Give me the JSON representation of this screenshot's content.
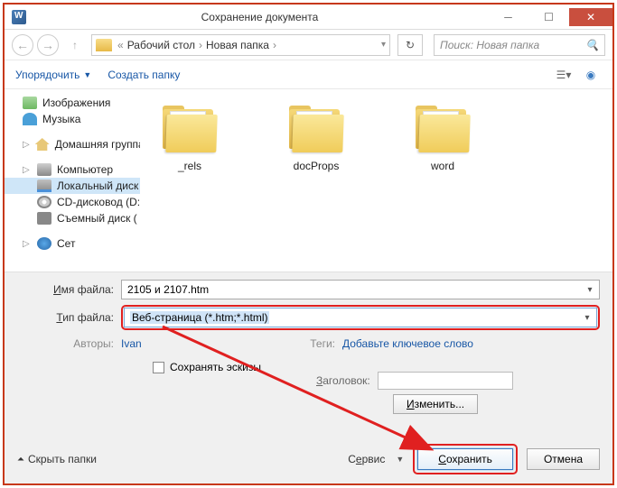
{
  "title": "Сохранение документа",
  "nav": {
    "back": "←",
    "forward": "→",
    "up": "↑",
    "breadcrumb": [
      "Рабочий стол",
      "Новая папка"
    ],
    "bc_prefix": "«",
    "refresh": "↻",
    "search_placeholder": "Поиск: Новая папка"
  },
  "toolbar": {
    "organize": "Упорядочить",
    "new_folder": "Создать папку"
  },
  "sidebar": {
    "items": [
      {
        "label": "Изображения",
        "icon": "pic"
      },
      {
        "label": "Музыка",
        "icon": "mus"
      },
      {
        "label": "",
        "spacer": true
      },
      {
        "label": "Домашняя группа",
        "icon": "home"
      },
      {
        "label": "",
        "spacer": true
      },
      {
        "label": "Компьютер",
        "icon": "comp"
      },
      {
        "label": "Локальный диск",
        "icon": "disk",
        "child": true,
        "selected": true
      },
      {
        "label": "CD-дисковод (D:",
        "icon": "cd",
        "child": true
      },
      {
        "label": "Съемный диск (",
        "icon": "usb",
        "child": true
      },
      {
        "label": "",
        "spacer": true
      },
      {
        "label": "Сет",
        "icon": "net"
      }
    ]
  },
  "folders": [
    {
      "name": "_rels",
      "type": "globe"
    },
    {
      "name": "docProps",
      "type": "plain"
    },
    {
      "name": "word",
      "type": "plain"
    }
  ],
  "form": {
    "filename_label": "Имя файла:",
    "filename_value": "2105 и 2107.htm",
    "filetype_label": "Тип файла:",
    "filetype_value": "Веб-страница (*.htm;*.html)",
    "authors_label": "Авторы:",
    "authors_value": "Ivan",
    "tags_label": "Теги:",
    "tags_value": "Добавьте ключевое слово",
    "save_thumb": "Сохранять эскизы",
    "title_label": "Заголовок:",
    "change_btn": "Изменить..."
  },
  "footer": {
    "hide_folders": "Скрыть папки",
    "service": "Сервис",
    "save": "Сохранить",
    "cancel": "Отмена"
  }
}
